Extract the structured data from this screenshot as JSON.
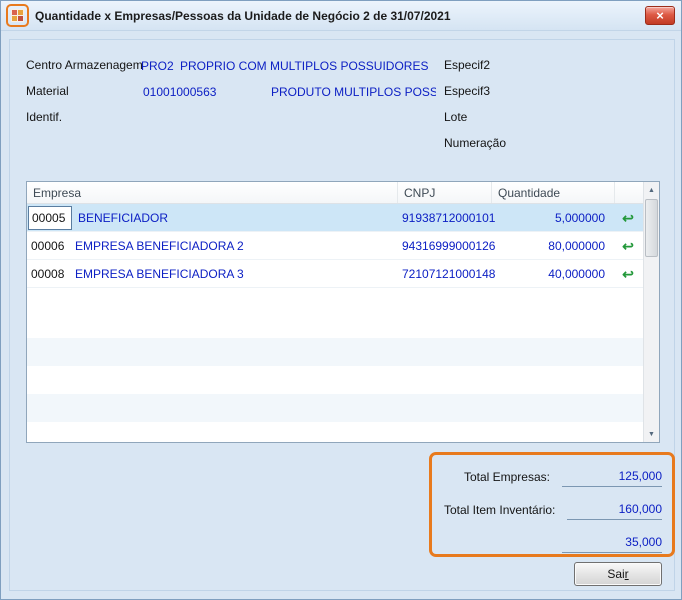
{
  "window": {
    "title": "Quantidade x Empresas/Pessoas da Unidade de Negócio 2 de 31/07/2021"
  },
  "icons": {
    "close": "×",
    "scroll_up": "▲",
    "scroll_down": "▼",
    "row_arrow": "↩"
  },
  "form": {
    "centro_label": "Centro Armazenagem",
    "centro_code": "PRO2",
    "centro_desc": "PROPRIO COM MULTIPLOS POSSUIDORES",
    "material_label": "Material",
    "material_code": "01001000563",
    "material_desc": "PRODUTO MULTIPLOS POSSUID",
    "identif_label": "Identif.",
    "especif2_label": "Especif2",
    "especif3_label": "Especif3",
    "lote_label": "Lote",
    "numeracao_label": "Numeração"
  },
  "table": {
    "headers": {
      "empresa": "Empresa",
      "cnpj": "CNPJ",
      "quantidade": "Quantidade"
    },
    "rows": [
      {
        "code": "00005",
        "name": "BENEFICIADOR",
        "cnpj": "91938712000101",
        "qty": "5,000000"
      },
      {
        "code": "00006",
        "name": "EMPRESA BENEFICIADORA 2",
        "cnpj": "94316999000126",
        "qty": "80,000000"
      },
      {
        "code": "00008",
        "name": "EMPRESA BENEFICIADORA 3",
        "cnpj": "72107121000148",
        "qty": "40,000000"
      }
    ]
  },
  "totals": {
    "empresas_label": "Total Empresas:",
    "empresas_value": "125,000",
    "inventario_label": "Total Item Inventário:",
    "inventario_value": "160,000",
    "extra_value": "35,000"
  },
  "footer": {
    "sair_pre": "Sai",
    "sair_key": "r"
  },
  "colors": {
    "highlight_orange": "#E87A1D",
    "value_blue": "#0D20C4",
    "selection_blue": "#CDE6F7",
    "arrow_green": "#23983A",
    "close_red": "#C23B24"
  }
}
